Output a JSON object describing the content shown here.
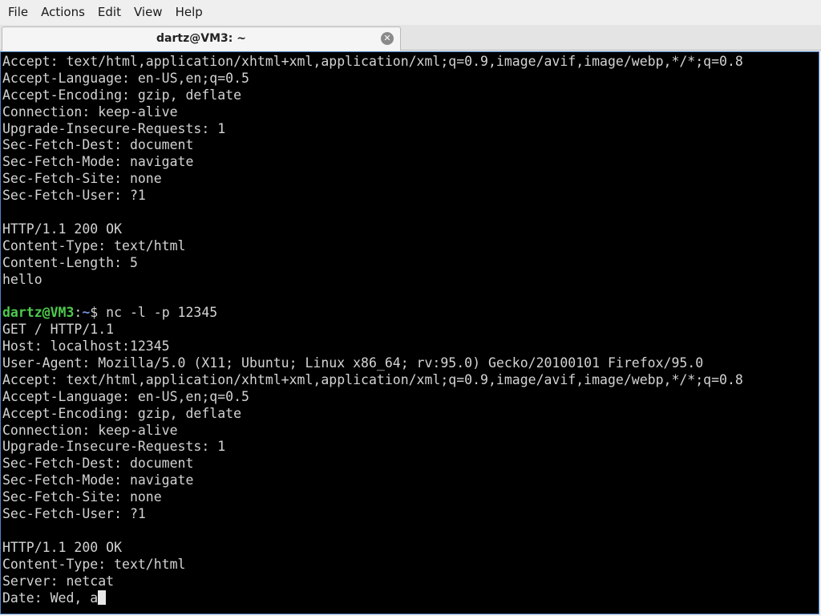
{
  "menubar": {
    "items": [
      "File",
      "Actions",
      "Edit",
      "View",
      "Help"
    ]
  },
  "tab": {
    "title": "dartz@VM3: ~",
    "close_icon": "close-icon"
  },
  "terminal": {
    "lines_before_prompt": [
      "Accept: text/html,application/xhtml+xml,application/xml;q=0.9,image/avif,image/webp,*/*;q=0.8",
      "Accept-Language: en-US,en;q=0.5",
      "Accept-Encoding: gzip, deflate",
      "Connection: keep-alive",
      "Upgrade-Insecure-Requests: 1",
      "Sec-Fetch-Dest: document",
      "Sec-Fetch-Mode: navigate",
      "Sec-Fetch-Site: none",
      "Sec-Fetch-User: ?1",
      "",
      "HTTP/1.1 200 OK",
      "Content-Type: text/html",
      "Content-Length: 5",
      "hello",
      ""
    ],
    "prompt": {
      "user_host": "dartz@VM3",
      "colon": ":",
      "path": "~",
      "dollar": "$ ",
      "command": "nc -l -p 12345"
    },
    "lines_after_prompt": [
      "GET / HTTP/1.1",
      "Host: localhost:12345",
      "User-Agent: Mozilla/5.0 (X11; Ubuntu; Linux x86_64; rv:95.0) Gecko/20100101 Firefox/95.0",
      "Accept: text/html,application/xhtml+xml,application/xml;q=0.9,image/avif,image/webp,*/*;q=0.8",
      "Accept-Language: en-US,en;q=0.5",
      "Accept-Encoding: gzip, deflate",
      "Connection: keep-alive",
      "Upgrade-Insecure-Requests: 1",
      "Sec-Fetch-Dest: document",
      "Sec-Fetch-Mode: navigate",
      "Sec-Fetch-Site: none",
      "Sec-Fetch-User: ?1",
      "",
      "HTTP/1.1 200 OK",
      "Content-Type: text/html",
      "Server: netcat"
    ],
    "input_line": "Date: Wed, a"
  },
  "colors": {
    "terminal_bg": "#000000",
    "terminal_fg": "#d3d3d3",
    "prompt_user": "#4ec94e",
    "prompt_path": "#6f8fdf",
    "terminal_border": "#4f86c6"
  }
}
